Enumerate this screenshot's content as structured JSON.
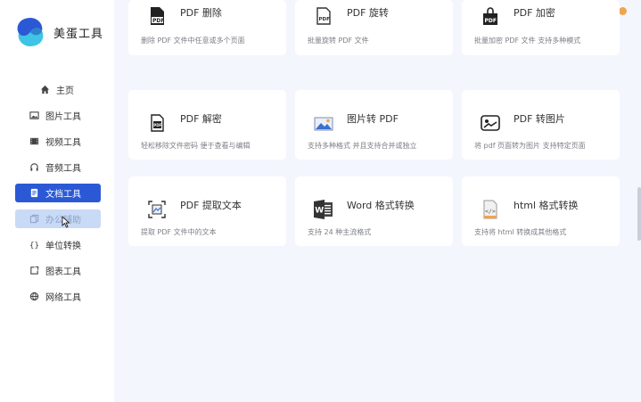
{
  "app": {
    "name": "美蛋工具"
  },
  "sidebar": {
    "items": [
      {
        "label": "主页",
        "icon": "home-icon"
      },
      {
        "label": "图片工具",
        "icon": "image-icon"
      },
      {
        "label": "视频工具",
        "icon": "video-icon"
      },
      {
        "label": "音频工具",
        "icon": "headphones-icon"
      },
      {
        "label": "文档工具",
        "icon": "document-icon",
        "state": "active"
      },
      {
        "label": "办公辅助",
        "icon": "copy-icon",
        "state": "hover"
      },
      {
        "label": "单位转换",
        "icon": "braces-icon"
      },
      {
        "label": "图表工具",
        "icon": "chart-icon"
      },
      {
        "label": "网络工具",
        "icon": "globe-icon"
      }
    ]
  },
  "colors": {
    "accent": "#2b59d6",
    "hover": "#c9daf6",
    "window_dot": "#f0a44b",
    "background": "#f3f6fd"
  },
  "cards": [
    {
      "title": "PDF 删除",
      "desc": "删除 PDF 文件中任意或多个页面",
      "icon": "pdf-delete-icon"
    },
    {
      "title": "PDF 旋转",
      "desc": "批量旋转 PDF 文件",
      "icon": "pdf-rotate-icon"
    },
    {
      "title": "PDF 加密",
      "desc": "批量加密 PDF 文件 支持多种模式",
      "icon": "pdf-encrypt-icon"
    },
    {
      "title": "PDF 解密",
      "desc": "轻松移除文件密码 便于查看与编辑",
      "icon": "pdf-decrypt-icon"
    },
    {
      "title": "图片转 PDF",
      "desc": "支持多种格式 并且支持合并或独立",
      "icon": "image-to-pdf-icon"
    },
    {
      "title": "PDF 转图片",
      "desc": "将 pdf 页面转为图片 支持特定页面",
      "icon": "pdf-to-image-icon"
    },
    {
      "title": "PDF 提取文本",
      "desc": "提取 PDF 文件中的文本",
      "icon": "pdf-extract-text-icon"
    },
    {
      "title": "Word 格式转换",
      "desc": "支持 24 种主流格式",
      "icon": "word-icon"
    },
    {
      "title": "html 格式转换",
      "desc": "支持将 html 转换成其他格式",
      "icon": "html-icon"
    }
  ]
}
